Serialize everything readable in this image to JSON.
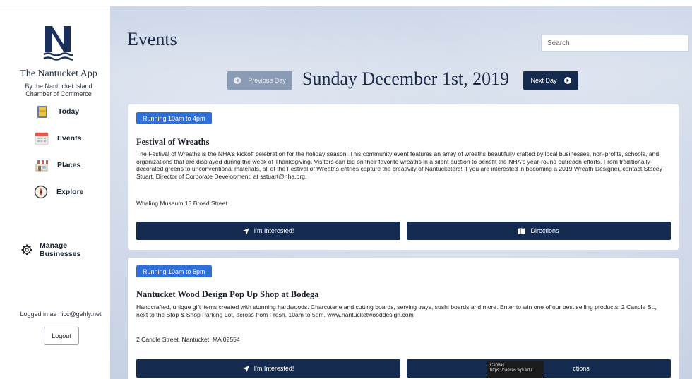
{
  "app": {
    "title": "The Nantucket App",
    "subtitle": "By the Nantucket Island Chamber of Commerce",
    "logo_icon": "nantucket-n-logo"
  },
  "sidebar": {
    "items": [
      {
        "label": "Today",
        "icon": "today-calendar-icon"
      },
      {
        "label": "Events",
        "icon": "events-calendar-icon"
      },
      {
        "label": "Places",
        "icon": "places-shop-icon"
      },
      {
        "label": "Explore",
        "icon": "compass-icon"
      }
    ],
    "manage": {
      "label_line1": "Manage",
      "label_line2": "Businesses",
      "icon": "gear-icon"
    },
    "logged_in_text": "Logged in as nicc@gehly.net",
    "logout_label": "Logout"
  },
  "main": {
    "page_title": "Events",
    "search_placeholder": "Search",
    "prev_label": "Previous Day",
    "next_label": "Next Day",
    "date_title": "Sunday December 1st, 2019"
  },
  "events": [
    {
      "badge": "Running 10am to 4pm",
      "title": "Festival of Wreaths",
      "description": "The Festival of Wreaths is the NHA's kickoff celebration for the holiday season! This community event features an array of wreaths beautifully crafted by local businesses, non-profits, schools, and organizations that are displayed during the week of Thanksgiving. Visitors can bid on their favorite wreaths in a silent auction to benefit the NHA's year-round outreach efforts. From traditionally-decorated greens to unconventional materials, all of the Festival of Wreaths entries capture the creativity of Nantucketers! If you are interested in becoming a 2019 Wreath Designer, contact Stacey Stuart, Director of Corporate Development, at sstuart@nha.org.",
      "location": "Whaling Museum 15 Broad Street",
      "interested_label": "I'm Interested!",
      "directions_label": "Directions"
    },
    {
      "badge": "Running 10am to 5pm",
      "title": "Nantucket Wood Design Pop Up Shop at Bodega",
      "description": "Handcrafted, unique gift items created with stunning hardwoods. Charcuterie and cutting boards, serving trays, sushi boards and more. Enter to win one of our best selling products. 2 Candle St., next to the Stop & Shop Parking Lot, across from Fresh. 10am to 5pm. www.nantucketwooddesign.com",
      "location": "2 Candle Street, Nantucket, MA 02554",
      "interested_label": "I'm Interested!",
      "directions_label": "ctions"
    }
  ],
  "tooltip": {
    "line1": "Canvas",
    "line2": "https://canvas.wpi.edu"
  },
  "colors": {
    "navy": "#142b4f",
    "badge_blue": "#2f6fd8",
    "prev_disabled": "#8a9bb5"
  }
}
